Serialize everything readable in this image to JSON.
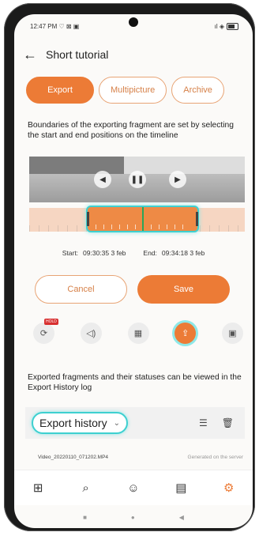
{
  "status_bar": {
    "time": "12:47 PM",
    "left_icons": "♡ ⊠ ▣",
    "right_icons": "ıl ◈"
  },
  "appbar": {
    "title": "Short tutorial"
  },
  "tabs": [
    {
      "label": "Export",
      "active": true
    },
    {
      "label": "Multipicture",
      "active": false
    },
    {
      "label": "Archive",
      "active": false
    }
  ],
  "export_description": "Boundaries of the exporting fragment are set by selecting the start and end positions on the timeline",
  "times": {
    "start_label": "Start:",
    "start_value": "09:30:35 3 feb",
    "end_label": "End:",
    "end_value": "09:34:18 3 feb"
  },
  "buttons": {
    "cancel": "Cancel",
    "save": "Save"
  },
  "tool_badge": "HOLD",
  "history_description": "Exported fragments and their statuses can be viewed in the Export History log",
  "history": {
    "dropdown_label": "Export history"
  },
  "file": {
    "name": "Video_20220110_071202.MP4",
    "status": "Generated on the server"
  },
  "colors": {
    "accent": "#ec7b36",
    "highlight": "#3ed0d0",
    "timeline_bg": "#f6d6c2"
  }
}
